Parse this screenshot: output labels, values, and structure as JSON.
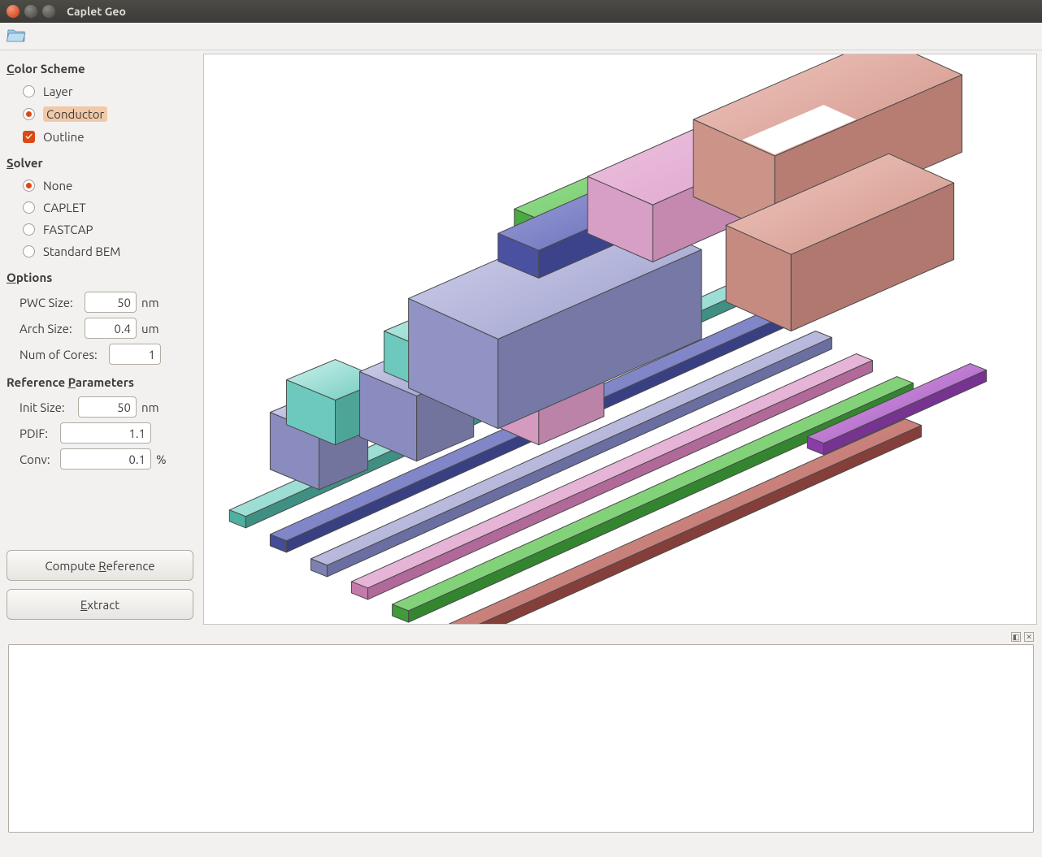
{
  "window": {
    "title": "Caplet Geo"
  },
  "sidebar": {
    "colorScheme": {
      "header": "Color Scheme",
      "header_ak": "C",
      "options": [
        {
          "label": "Layer",
          "checked": false
        },
        {
          "label": "Conductor",
          "checked": true
        },
        {
          "label": "Outline",
          "type": "check",
          "checked": true
        }
      ]
    },
    "solver": {
      "header": "Solver",
      "header_ak": "S",
      "options": [
        {
          "label": "None",
          "checked": true
        },
        {
          "label": "CAPLET",
          "checked": false
        },
        {
          "label": "FASTCAP",
          "checked": false
        },
        {
          "label": "Standard BEM",
          "checked": false
        }
      ]
    },
    "options": {
      "header": "Options",
      "header_ak": "O",
      "pwc": {
        "label": "PWC Size:",
        "value": "50",
        "unit": "nm"
      },
      "arch": {
        "label": "Arch Size:",
        "value": "0.4",
        "unit": "um"
      },
      "cores": {
        "label": "Num of Cores:",
        "value": "1",
        "unit": ""
      }
    },
    "reference": {
      "header": "Reference Parameters",
      "header_ak": "P",
      "init": {
        "label": "Init Size:",
        "value": "50",
        "unit": "nm"
      },
      "pdif": {
        "label": "PDIF:",
        "value": "1.1",
        "unit": ""
      },
      "conv": {
        "label": "Conv:",
        "value": "0.1",
        "unit": "%"
      }
    },
    "buttons": {
      "compute": "Compute Reference",
      "compute_ak": "R",
      "extract": "Extract",
      "extract_ak": "E"
    }
  }
}
